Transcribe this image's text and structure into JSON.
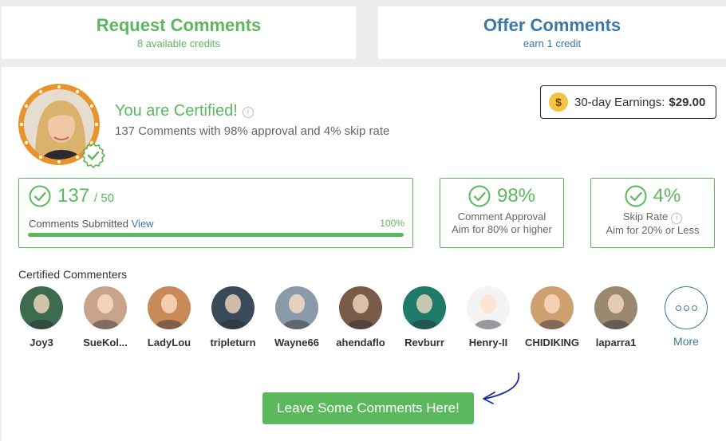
{
  "tabs": {
    "request": {
      "title": "Request Comments",
      "subtitle": "8 available credits"
    },
    "offer": {
      "title": "Offer Comments",
      "subtitle": "earn 1 credit"
    }
  },
  "certification": {
    "title": "You are Certified!",
    "info_icon": "i",
    "summary": "137 Comments with 98% approval and 4% skip rate"
  },
  "earnings": {
    "coin_symbol": "$",
    "label": "30-day Earnings:",
    "amount": "$29.00"
  },
  "stats": {
    "submitted": {
      "count": "137",
      "goal": "/ 50",
      "label": "Comments Submitted",
      "link": "View",
      "progress_text": "100%",
      "progress": 1.0
    },
    "approval": {
      "value": "98%",
      "label": "Comment Approval",
      "hint": "Aim for 80% or higher"
    },
    "skip": {
      "value": "4%",
      "label": "Skip Rate",
      "hint": "Aim for 20% or Less"
    }
  },
  "commenters": {
    "heading": "Certified Commenters",
    "items": [
      {
        "name": "Joy3",
        "icon": "avatar-joy3",
        "color": "#3d6b4f"
      },
      {
        "name": "SueKol...",
        "icon": "avatar-suekol",
        "color": "#c9a48a"
      },
      {
        "name": "LadyLou",
        "icon": "avatar-ladylou",
        "color": "#c98a5a"
      },
      {
        "name": "tripleturn",
        "icon": "avatar-tripleturn",
        "color": "#3a4a58"
      },
      {
        "name": "Wayne66",
        "icon": "avatar-wayne66",
        "color": "#8a9aa8"
      },
      {
        "name": "ahendaflo",
        "icon": "avatar-ahendaflo",
        "color": "#7a5a48"
      },
      {
        "name": "Revburr",
        "icon": "avatar-revburr",
        "color": "#1f7a6a"
      },
      {
        "name": "Henry-II",
        "icon": "avatar-henry",
        "color": "#f4f4f4"
      },
      {
        "name": "CHIDIKING",
        "icon": "avatar-chidiking",
        "color": "#d0a070"
      },
      {
        "name": "laparra1",
        "icon": "avatar-laparra1",
        "color": "#9a8870"
      }
    ],
    "more_label": "More"
  },
  "cta": {
    "label": "Leave Some Comments Here!"
  },
  "colors": {
    "green": "#5cb85c",
    "blue": "#3a78a8"
  }
}
